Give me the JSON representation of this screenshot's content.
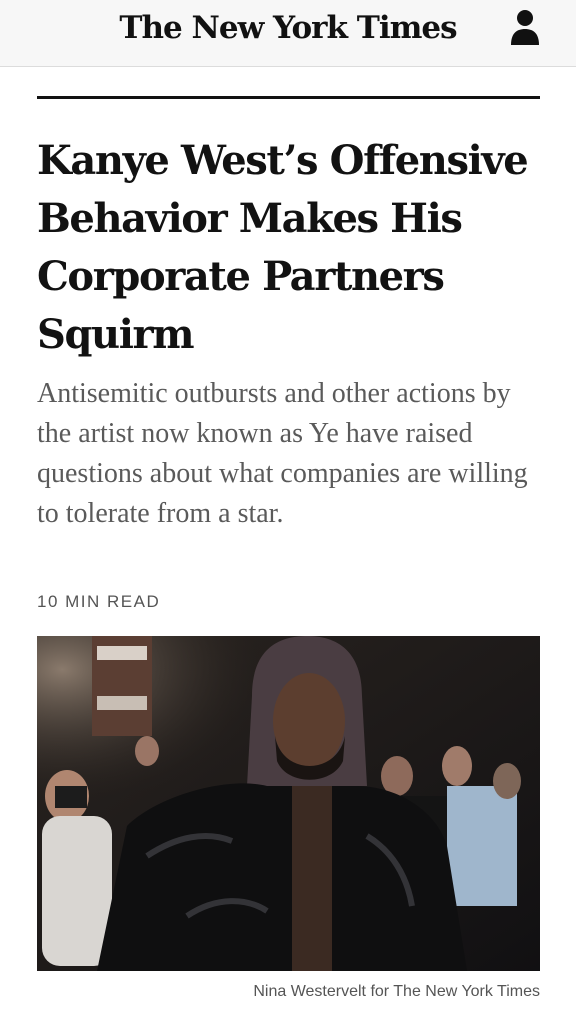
{
  "header": {
    "masthead": "The New York Times",
    "account_icon": "person-icon"
  },
  "article": {
    "headline": "Kanye West’s Offensive Behavior Makes His Corporate Partners Squirm",
    "summary": "Antisemitic outbursts and other actions by the artist now known as Ye have raised questions about what companies are willing to tolerate from a star.",
    "read_time": "10 MIN READ",
    "photo_credit": "Nina Westervelt for The New York Times"
  },
  "colors": {
    "text": "#121212",
    "summary": "#5a5a5a",
    "topbar": "#f7f7f7"
  }
}
